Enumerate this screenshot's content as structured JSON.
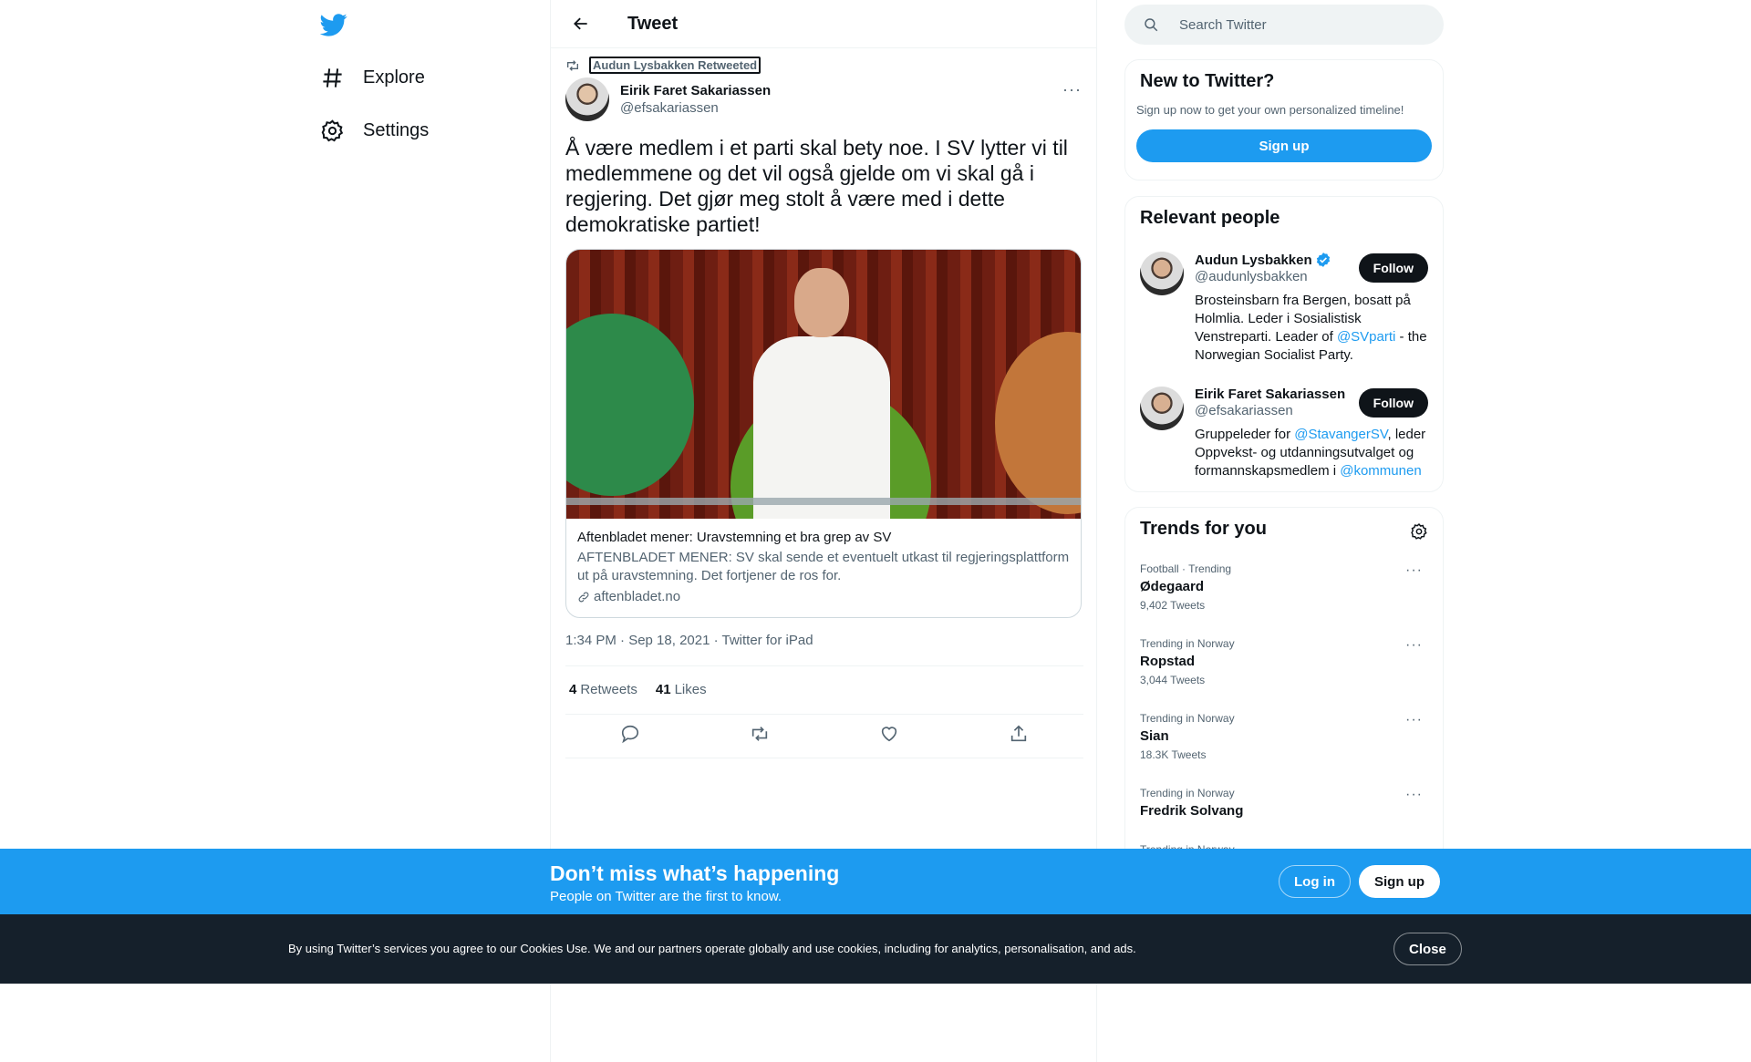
{
  "nav": {
    "logo": "twitter-bird-icon",
    "items": [
      {
        "label": "Explore",
        "icon": "hashtag-icon"
      },
      {
        "label": "Settings",
        "icon": "gear-icon"
      }
    ]
  },
  "main": {
    "title": "Tweet",
    "retweeted_by": "Audun Lysbakken Retweeted",
    "author": {
      "name": "Eirik Faret Sakariassen",
      "handle": "@efsakariassen"
    },
    "more": "···",
    "text": "Å være medlem i et parti skal bety noe. I SV lytter vi til medlemmene og det vil også gjelde om vi skal gå i regjering. Det gjør meg stolt å være med i dette demokratiske partiet!",
    "card": {
      "title": "Aftenbladet mener: Uravstemning et bra grep av SV",
      "description": "AFTENBLADET MENER: SV skal sende et eventuelt utkast til regjeringsplattform ut på uravstemning. Det fortjener de ros for.",
      "domain": "aftenbladet.no"
    },
    "meta": "1:34 PM · Sep 18, 2021 · Twitter for iPad",
    "stats": {
      "retweets_count": "4",
      "retweets_label": "Retweets",
      "likes_count": "41",
      "likes_label": "Likes"
    }
  },
  "search": {
    "placeholder": "Search Twitter"
  },
  "new_to_twitter": {
    "title": "New to Twitter?",
    "subtitle": "Sign up now to get your own personalized timeline!",
    "signup_label": "Sign up"
  },
  "relevant_people": {
    "title": "Relevant people",
    "people": [
      {
        "name": "Audun Lysbakken",
        "handle": "@audunlysbakken",
        "verified": true,
        "follow_label": "Follow",
        "bio_pre": "Brosteinsbarn fra Bergen, bosatt på Holmlia. Leder i Sosialistisk Venstreparti. Leader of ",
        "bio_link1": "@SVparti",
        "bio_mid": " - the Norwegian Socialist Party.",
        "bio_link2": "",
        "bio_post": ""
      },
      {
        "name": "Eirik Faret Sakariassen",
        "handle": "@efsakariassen",
        "verified": false,
        "follow_label": "Follow",
        "bio_pre": "Gruppeleder for ",
        "bio_link1": "@StavangerSV",
        "bio_mid": ", leder Oppvekst- og utdanningsutvalget og formannskapsmedlem i ",
        "bio_link2": "@kommunen",
        "bio_post": ""
      }
    ]
  },
  "trends": {
    "title": "Trends for you",
    "items": [
      {
        "context": "Football · Trending",
        "name": "Ødegaard",
        "count": "9,402 Tweets"
      },
      {
        "context": "Trending in Norway",
        "name": "Ropstad",
        "count": "3,044 Tweets"
      },
      {
        "context": "Trending in Norway",
        "name": "Sian",
        "count": "18.3K Tweets"
      },
      {
        "context": "Trending in Norway",
        "name": "Fredrik Solvang",
        "count": ""
      },
      {
        "context": "Trending in Norway",
        "name": "",
        "count": ""
      }
    ],
    "more": "···"
  },
  "bottom_bar": {
    "title": "Don’t miss what’s happening",
    "subtitle": "People on Twitter are the first to know.",
    "login_label": "Log in",
    "signup_label": "Sign up"
  },
  "cookie_bar": {
    "text": "By using Twitter’s services you agree to our Cookies Use. We and our partners operate globally and use cookies, including for analytics, personalisation, and ads.",
    "close_label": "Close"
  },
  "colors": {
    "accent": "#1d9bf0",
    "text": "#0f1419",
    "secondary": "#536471",
    "dark": "#0f1419"
  }
}
